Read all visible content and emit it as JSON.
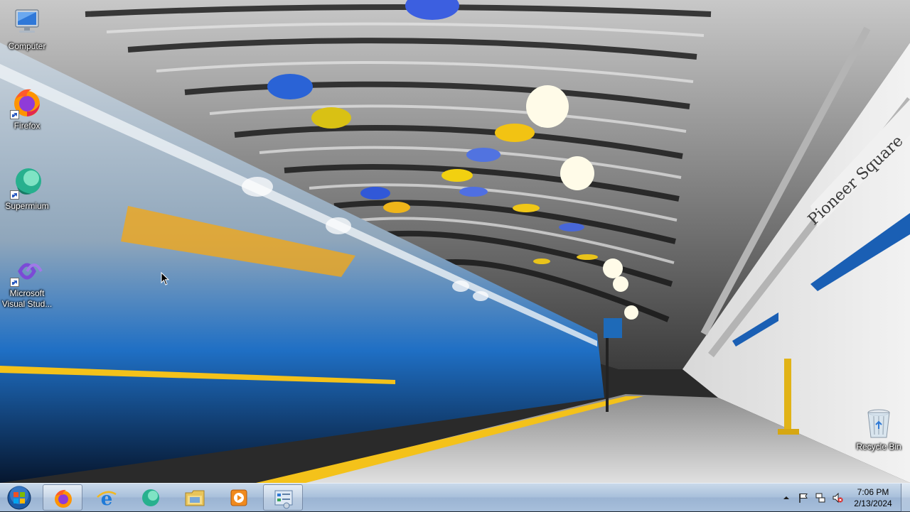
{
  "desktop_icons": [
    {
      "label": "Computer",
      "icon": "computer-icon"
    },
    {
      "label": "Firefox",
      "icon": "firefox-icon"
    },
    {
      "label": "Supermium",
      "icon": "supermium-icon"
    },
    {
      "label": "Microsoft Visual Stud...",
      "icon": "visual-studio-icon"
    },
    {
      "label": "Recycle Bin",
      "icon": "recycle-bin-icon"
    }
  ],
  "wallpaper": {
    "sign_text": "Pioneer Square"
  },
  "taskbar": {
    "pinned": [
      {
        "name": "Firefox",
        "icon": "firefox-icon",
        "active": true
      },
      {
        "name": "Internet Explorer",
        "icon": "internet-explorer-icon",
        "active": false
      },
      {
        "name": "Supermium",
        "icon": "supermium-icon",
        "active": false
      },
      {
        "name": "Windows Explorer",
        "icon": "folder-icon",
        "active": false
      },
      {
        "name": "Windows Media Player",
        "icon": "media-player-icon",
        "active": false
      },
      {
        "name": "Control Panel",
        "icon": "control-panel-icon",
        "active": true
      }
    ],
    "tray": {
      "icons": [
        "show-hidden-icons-arrow",
        "action-center-flag-icon",
        "network-icon",
        "volume-muted-icon"
      ],
      "time": "7:06 PM",
      "date": "2/13/2024"
    }
  },
  "colors": {
    "taskbar": "#a9c0db",
    "accent_blue": "#1a5fb4",
    "accent_yellow": "#f4c21a"
  }
}
